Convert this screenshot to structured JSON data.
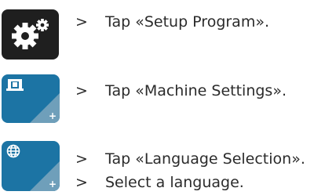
{
  "steps": [
    {
      "bullet": ">",
      "text": "Tap «Setup Program»."
    },
    {
      "bullet": ">",
      "text": "Tap «Machine Settings»."
    },
    {
      "bullet": ">",
      "text": "Tap «Language Selection»."
    },
    {
      "bullet": ">",
      "text": "Select a language."
    }
  ],
  "icons": {
    "setup": "gears-icon",
    "machine": "sewing-machine-icon",
    "language": "globe-icon",
    "corner": "plus-corner-icon"
  },
  "colors": {
    "dark_tile": "#1f1f1f",
    "blue_tile": "#1c74a4"
  }
}
